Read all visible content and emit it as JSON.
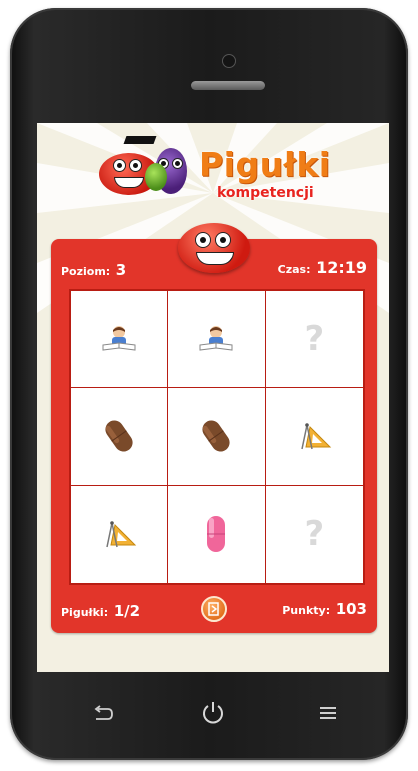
{
  "app": {
    "title": "Pigułki",
    "subtitle": "kompetencji"
  },
  "hud": {
    "level_label": "Poziom:",
    "level_value": "3",
    "time_label": "Czas:",
    "time_value": "12:19",
    "pills_label": "Pigułki:",
    "pills_value": "1/2",
    "points_label": "Punkty:",
    "points_value": "103"
  },
  "board": {
    "rows": 3,
    "cols": 3,
    "cells": [
      {
        "kind": "student",
        "icon": "student-reading-icon"
      },
      {
        "kind": "student",
        "icon": "student-reading-icon"
      },
      {
        "kind": "hidden",
        "icon": "question-mark-icon",
        "text": "?"
      },
      {
        "kind": "brown-pill",
        "icon": "brown-pill-icon"
      },
      {
        "kind": "brown-pill",
        "icon": "brown-pill-icon"
      },
      {
        "kind": "geometry",
        "icon": "geometry-tools-icon"
      },
      {
        "kind": "geometry",
        "icon": "geometry-tools-icon"
      },
      {
        "kind": "pink-pill",
        "icon": "pink-pill-icon"
      },
      {
        "kind": "hidden",
        "icon": "question-mark-icon",
        "text": "?"
      }
    ]
  },
  "controls": {
    "exit_icon": "exit-door-icon"
  },
  "device_nav": {
    "back_icon": "back-arrow-icon",
    "power_icon": "power-icon",
    "menu_icon": "menu-icon"
  },
  "colors": {
    "panel_red": "#e2352a",
    "panel_border": "#b81d13",
    "logo_orange": "#f07d16",
    "logo_red": "#e8241f",
    "screen_bg": "#f3f0e2",
    "pill_brown": "#7a4a2a",
    "pill_pink": "#f0669a"
  }
}
